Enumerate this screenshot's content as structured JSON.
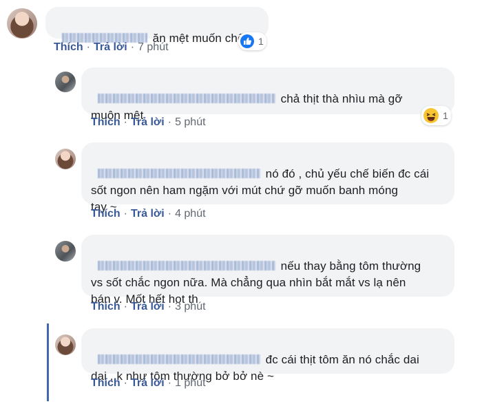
{
  "comments": [
    {
      "text": "ăn mệt muốn chết ~",
      "like_label": "Thích",
      "reply_label": "Trả lời",
      "time": "7 phút",
      "reaction_count": "1",
      "reaction_icon": "thumbs-up-icon"
    },
    {
      "text": "chả thịt thà nhìu mà gỡ\nmuôn mệt",
      "like_label": "Thích",
      "reply_label": "Trả lời",
      "time": "5 phút",
      "reaction_count": "1",
      "reaction_icon": "laughing-emoji-icon"
    },
    {
      "text": "nó đó , chủ yếu chế biến đc cái\nsốt ngon nên ham ngặm với mút chứ gỡ muốn banh móng\ntay ~",
      "like_label": "Thích",
      "reply_label": "Trả lời",
      "time": "4 phút"
    },
    {
      "text": "nếu thay bằng tôm thường\nvs sốt chắc ngon nữa. Mà chẳng qua nhìn bắt mắt vs lạ nên\nbán v. Mốt hết hot th",
      "like_label": "Thích",
      "reply_label": "Trả lời",
      "time": "3 phút"
    },
    {
      "text": "đc cái thịt tôm ăn nó chắc dai\ndai , k như tôm thường bở bở nè ~",
      "like_label": "Thích",
      "reply_label": "Trả lời",
      "time": "1 phút"
    }
  ],
  "separator": "·",
  "colors": {
    "bubble": "#f2f3f5",
    "link": "#385898",
    "thread_line": "#4267b2"
  }
}
